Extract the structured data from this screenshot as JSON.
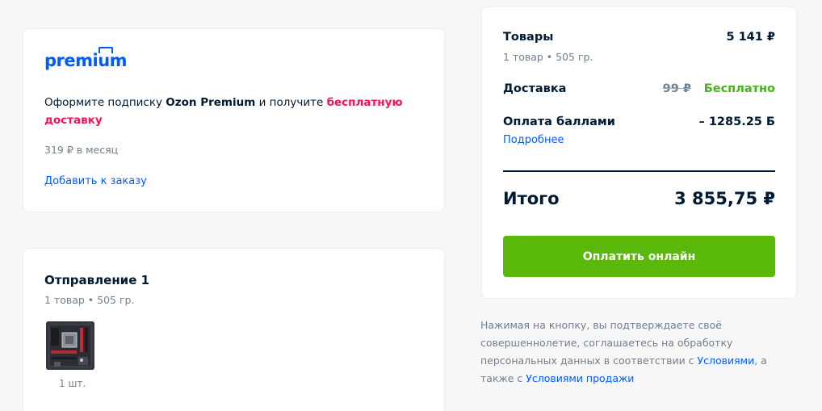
{
  "premium": {
    "logo_text_pre": "premi",
    "logo_text_crown": "u",
    "logo_text_post": "m",
    "offer_prefix": "Оформите подписку ",
    "offer_brand": "Ozon Premium",
    "offer_middle": " и получите ",
    "offer_highlight": "бесплатную доставку",
    "price": "319 ₽ в месяц",
    "add_link": "Добавить к заказу"
  },
  "shipment": {
    "title": "Отправление 1",
    "subtitle": "1 товар • 505 гр.",
    "quantity": "1 шт.",
    "product_image": "motherboard-thumbnail"
  },
  "summary": {
    "goods_label": "Товары",
    "goods_value": "5 141 ₽",
    "goods_sub": "1 товар • 505 гр.",
    "delivery_label": "Доставка",
    "delivery_old_price": "99 ₽",
    "delivery_value": "Бесплатно",
    "points_label": "Оплата баллами",
    "points_value": "– 1285.25 Б",
    "details_link": "Подробнее",
    "total_label": "Итого",
    "total_value": "3 855,75 ₽",
    "pay_button": "Оплатить онлайн"
  },
  "legal": {
    "text_1": "Нажимая на кнопку, вы подтверждаете своё совершеннолетие, соглашаетесь на обработку персональных данных в соответствии с ",
    "link_1": "Условиями",
    "text_2": ", а также с ",
    "link_2": "Условиями продажи"
  },
  "colors": {
    "brand_blue": "#005bff",
    "accent_pink": "#f91155",
    "success_green": "#41b614",
    "button_green": "#5ab80a",
    "text_dark": "#001a34",
    "text_muted": "#707f8d",
    "background": "#f7f7f7"
  }
}
